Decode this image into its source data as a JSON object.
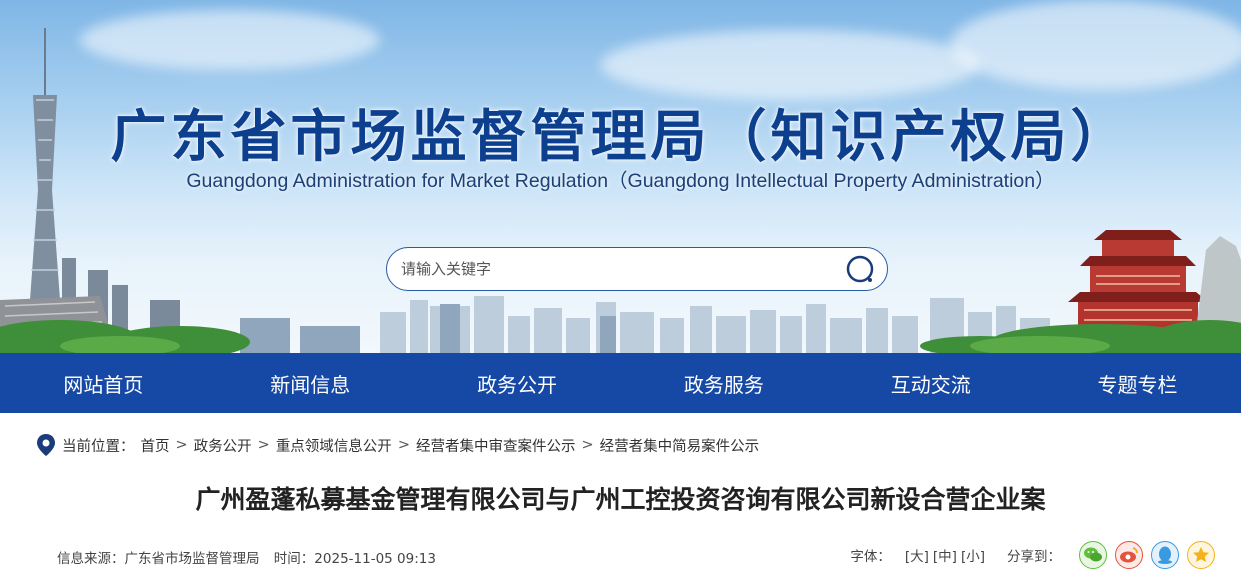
{
  "header": {
    "title": "广东省市场监督管理局（知识产权局）",
    "subtitle": "Guangdong Administration for Market Regulation（Guangdong Intellectual Property Administration）"
  },
  "search": {
    "placeholder": "请输入关键字",
    "icon": "search-icon"
  },
  "nav": {
    "items": [
      "网站首页",
      "新闻信息",
      "政务公开",
      "政务服务",
      "互动交流",
      "专题专栏"
    ]
  },
  "breadcrumb": {
    "label": "当前位置：",
    "items": [
      "首页",
      "政务公开",
      "重点领域信息公开",
      "经营者集中审查案件公示",
      "经营者集中简易案件公示"
    ],
    "separator": ">"
  },
  "article": {
    "title": "广州盈蓬私募基金管理有限公司与广州工控投资咨询有限公司新设合营企业案",
    "source": "信息来源：广东省市场监督管理局",
    "time": "时间：2025-11-05 09:13"
  },
  "tools": {
    "font_label": "字体：",
    "font_large": "[大]",
    "font_medium": "[中]",
    "font_small": "[小]",
    "share_label": "分享到：",
    "share_icons": [
      "wechat-icon",
      "weibo-icon",
      "qq-icon",
      "qzone-icon"
    ]
  },
  "colors": {
    "nav_bg": "#1649a5",
    "title_blue": "#0d3f8f",
    "wechat": "#5fbf3c",
    "weibo": "#e2543e",
    "qq": "#3a9ae0",
    "qzone": "#f5b21a"
  }
}
